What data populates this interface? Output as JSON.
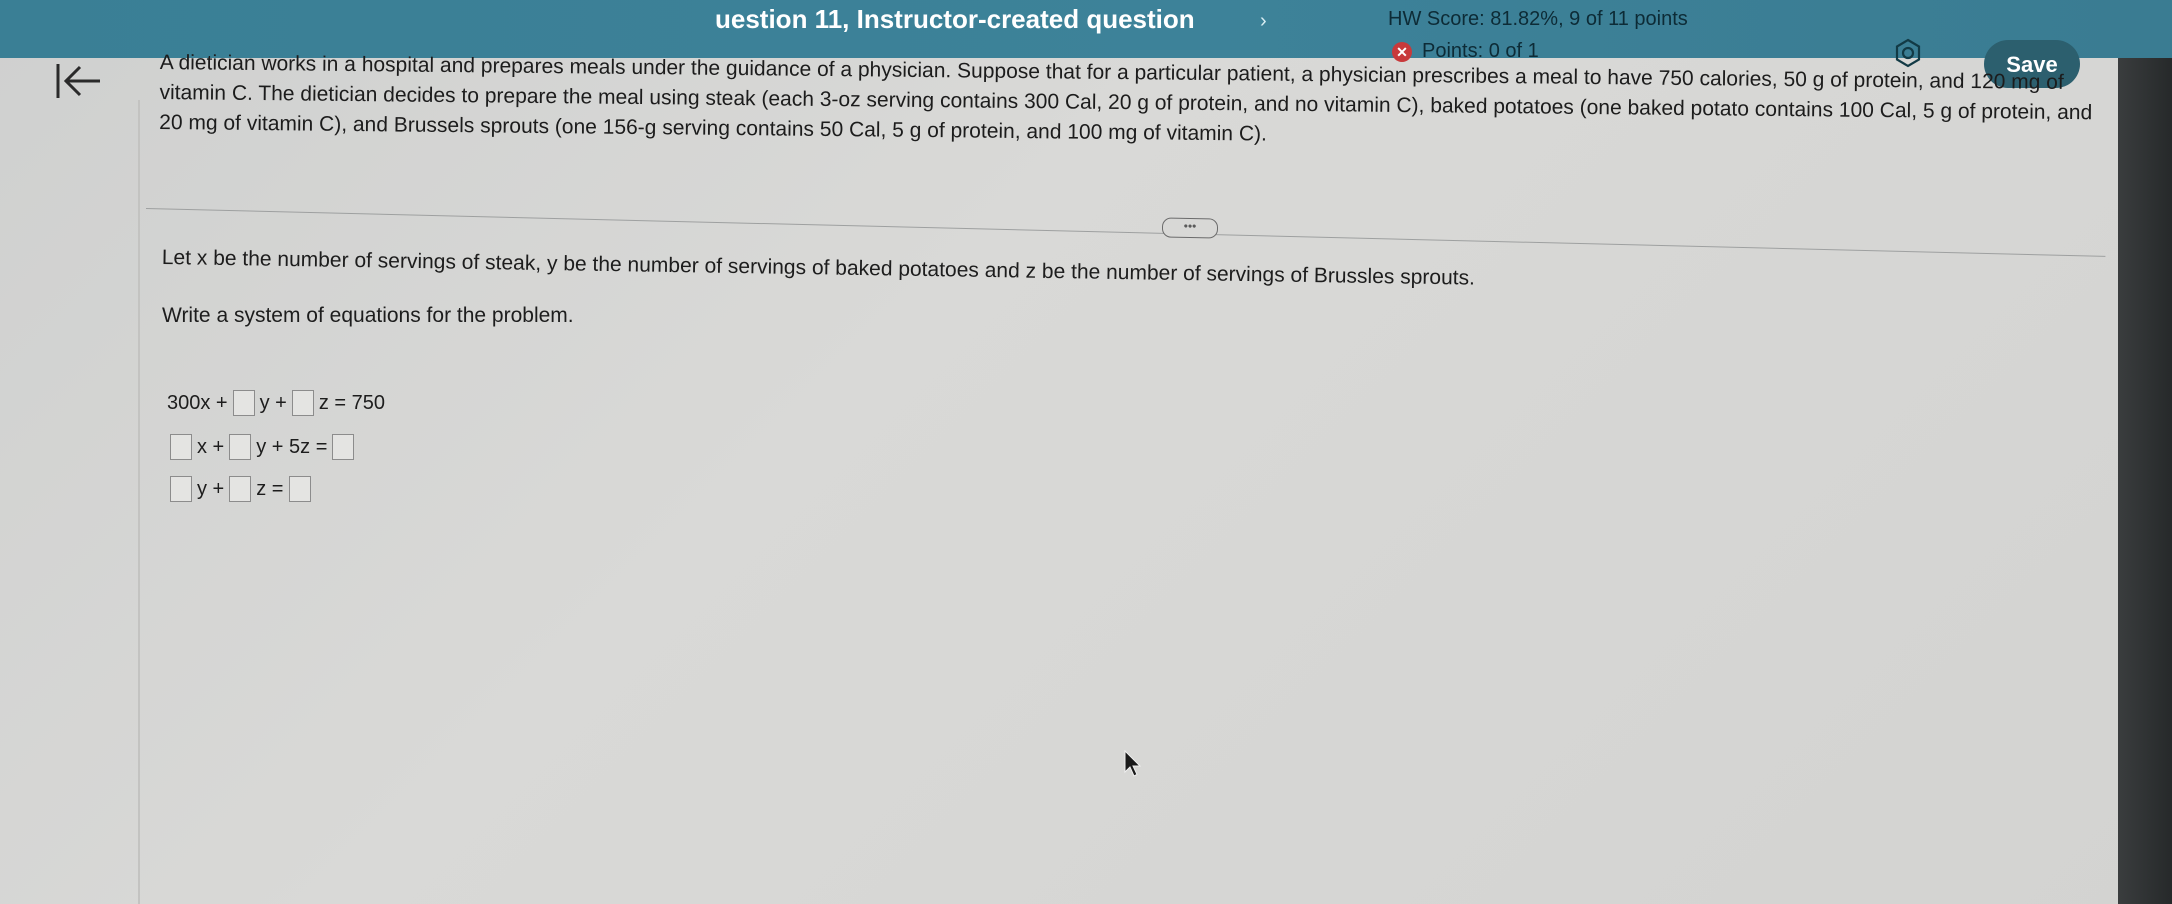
{
  "header": {
    "question_title": "uestion 11, Instructor-created question",
    "chevron": "›",
    "hw_score": "HW Score: 81.82%, 9 of 11 points",
    "points": "Points: 0 of 1",
    "save_label": "Save"
  },
  "problem": {
    "statement": "A dietician works in a hospital and prepares meals under the guidance of a physician. Suppose that for a particular patient, a physician prescribes a meal to have 750 calories, 50 g of protein, and 120 mg of vitamin C. The dietician decides to prepare the meal using steak (each 3-oz serving contains 300 Cal, 20 g of protein, and no vitamin C), baked potatoes (one baked potato contains 100 Cal, 5 g of protein, and 20 mg of vitamin C), and Brussels sprouts (one 156-g serving contains 50 Cal, 5 g of protein, and 100 mg of vitamin C).",
    "more_label": "•••",
    "let_text": "Let x be the number of servings of steak, y be the number of servings of baked potatoes and z be the number of servings of Brussles sprouts.",
    "instruction": "Write a system of equations for the problem."
  },
  "equations": {
    "row1": {
      "lead": "300x +",
      "t1": "y +",
      "t2": "z = 750"
    },
    "row2": {
      "t1": "x +",
      "t2": "y + 5z ="
    },
    "row3": {
      "t1": "y +",
      "t2": "z ="
    }
  }
}
